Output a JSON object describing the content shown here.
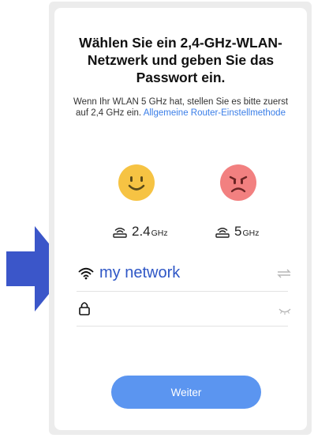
{
  "title": "Wählen Sie ein 2,4-GHz-WLAN-Netzwerk und geben Sie das Passwort ein.",
  "description": {
    "text": "Wenn Ihr WLAN 5 GHz hat, stellen Sie es bitte zuerst auf 2,4 GHz ein.",
    "link": "Allgemeine Router-Einstellmethode"
  },
  "bands": [
    {
      "value": "2.4",
      "unit": "GHz",
      "status": "supported",
      "face_color": "#f6c343"
    },
    {
      "value": "5",
      "unit": "GHz",
      "status": "unsupported",
      "face_color": "#f28080"
    }
  ],
  "wifi_field": {
    "value": "my network"
  },
  "password_field": {
    "value": ""
  },
  "next_button": {
    "label": "Weiter"
  },
  "colors": {
    "accent": "#5b95f0",
    "link": "#3a7ee8",
    "ssid_text": "#2f57c6",
    "arrow": "#3b56c9"
  }
}
